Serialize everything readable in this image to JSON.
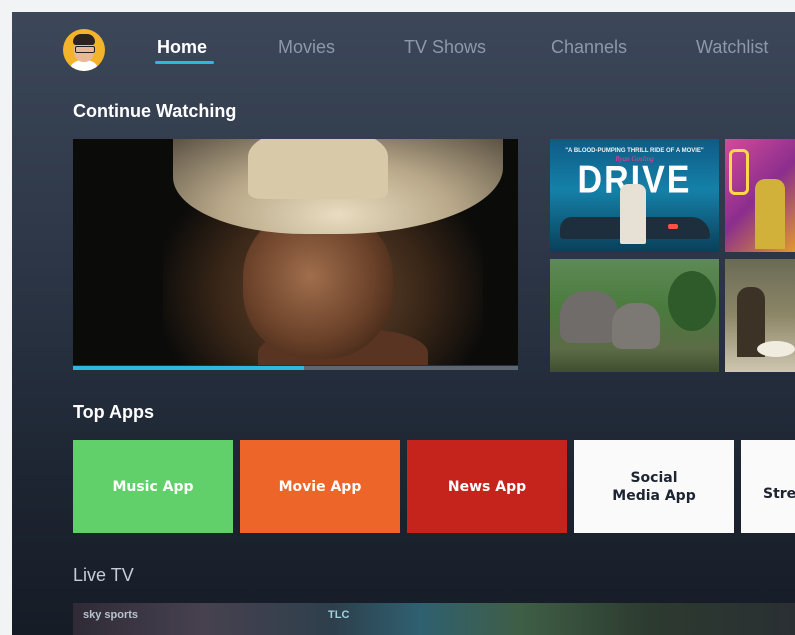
{
  "nav": {
    "items": [
      {
        "label": "Home",
        "active": true
      },
      {
        "label": "Movies",
        "active": false
      },
      {
        "label": "TV Shows",
        "active": false
      },
      {
        "label": "Channels",
        "active": false
      },
      {
        "label": "Watchlist",
        "active": false
      }
    ]
  },
  "continue_watching": {
    "title": "Continue Watching",
    "progress_fraction": 0.52,
    "thumbnails": {
      "drive": {
        "tagline": "\"A BLOOD-PUMPING THRILL RIDE OF A MOVIE\"",
        "credit": "Ryan Gosling",
        "title": "DRIVE"
      }
    }
  },
  "top_apps": {
    "title": "Top Apps",
    "tiles": [
      {
        "label": "Music App"
      },
      {
        "label": "Movie App"
      },
      {
        "label": "News App"
      },
      {
        "label": "Social\nMedia App"
      },
      {
        "label": "Stre"
      }
    ]
  },
  "live_tv": {
    "title": "Live TV",
    "channels": [
      "sky sports",
      "TLC"
    ]
  },
  "colors": {
    "accent": "#2cb8e0",
    "music": "#62d06a",
    "movie": "#ee6529",
    "news": "#c5241c",
    "social": "#fafafa"
  }
}
